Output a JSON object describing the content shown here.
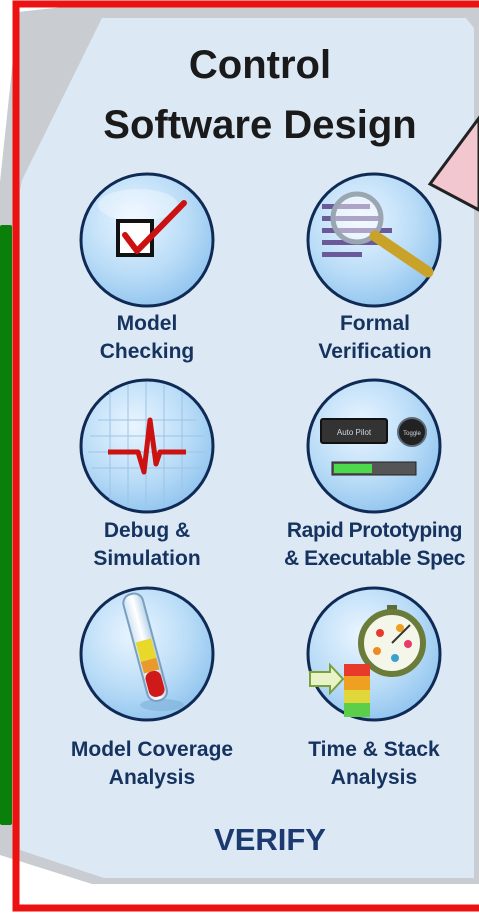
{
  "title": {
    "line1": "Control",
    "line2": "Software Design"
  },
  "footer": "VERIFY",
  "features": [
    {
      "line1": "Model",
      "line2": "Checking",
      "icon": "checkbox-icon"
    },
    {
      "line1": "Formal",
      "line2": "Verification",
      "icon": "magnifier-icon"
    },
    {
      "line1": "Debug &",
      "line2": "Simulation",
      "icon": "heartbeat-icon"
    },
    {
      "line1": "Rapid Prototyping",
      "line2": "& Executable Spec",
      "icon": "control-panel-icon"
    },
    {
      "line1": "Model Coverage",
      "line2": "Analysis",
      "icon": "test-tube-icon"
    },
    {
      "line1": "Time & Stack",
      "line2": "Analysis",
      "icon": "stopwatch-icon"
    }
  ],
  "panel": {
    "button_text": "Auto Pilot",
    "toggle_text": "Toggle"
  },
  "colors": {
    "frame": "#ee1111",
    "green_bar": "#0a7f0a",
    "hexagon": "#dce9f5",
    "circle": "#c6e2fa",
    "label": "#16335f"
  }
}
